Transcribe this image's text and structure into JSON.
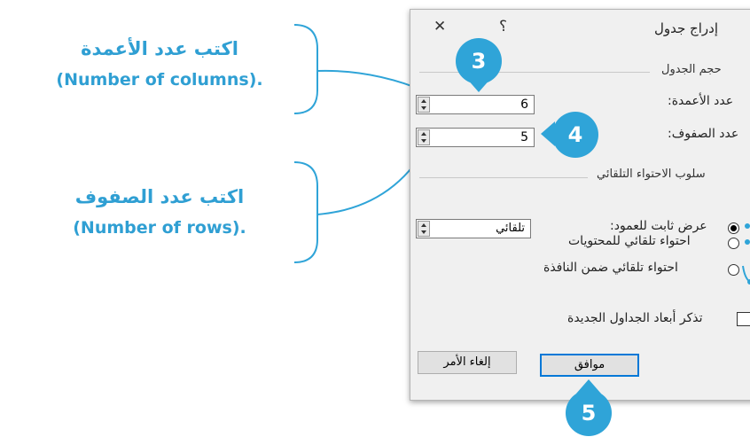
{
  "dialog": {
    "title": "إدراج جدول",
    "help_icon_label": "؟",
    "close_icon_label": "✕",
    "table_size_section": "حجم الجدول",
    "columns_label": "عدد الأعمدة:",
    "columns_value": "6",
    "rows_label": "عدد الصفوف:",
    "rows_value": "5",
    "autofit_section": "سلوب الاحتواء التلقائي",
    "fixed_width_label": "عرض ثابت للعمود:",
    "fixed_width_value": "تلقائي",
    "autofit_contents_label": "احتواء تلقائي للمحتويات",
    "autofit_window_label": "احتواء تلقائي ضمن النافذة",
    "remember_label": "تذكر أبعاد الجداول الجديدة",
    "ok_label": "موافق",
    "cancel_label": "إلغاء الأمر"
  },
  "callouts": {
    "columns_ar": "اكتب عدد الأعمدة",
    "columns_en": "(Number of columns).",
    "rows_ar": "اكتب عدد الصفوف",
    "rows_en": "(Number of rows)."
  },
  "badges": {
    "columns": "3",
    "rows": "4",
    "ok": "5"
  },
  "colors": {
    "accent": "#2fa4d8",
    "callout_text": "#2f9fd3",
    "dialog_bg": "#f0f0f0",
    "default_button_border": "#0078d7"
  }
}
